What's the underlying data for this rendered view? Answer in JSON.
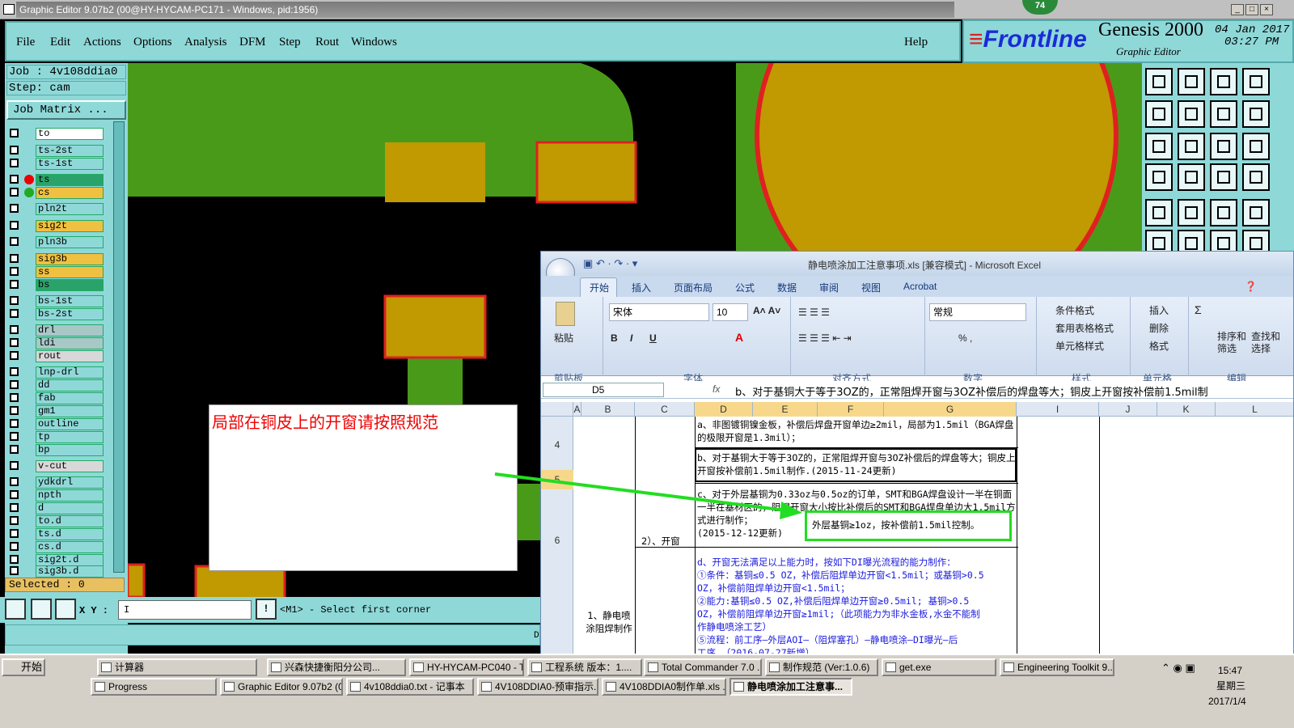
{
  "genesis": {
    "title": "Graphic Editor 9.07b2 (00@HY-HYCAM-PC171 - Windows, pid:1956)",
    "badge": "74",
    "menu": [
      "File",
      "Edit",
      "Actions",
      "Options",
      "Analysis",
      "DFM",
      "Step",
      "Rout",
      "Windows"
    ],
    "help": "Help",
    "brand": "Frontline",
    "product": "Genesis 2000",
    "subtitle": "Graphic Editor",
    "date": "04 Jan 2017",
    "time": "03:27 PM",
    "job": "Job : 4v108ddia0",
    "step": "Step: cam",
    "job_matrix": "Job Matrix ...",
    "layers": [
      {
        "name": "to",
        "color": "#ffffff"
      },
      {
        "name": "ts-2st",
        "color": "#8fd8d8"
      },
      {
        "name": "ts-1st",
        "color": "#8fd8d8"
      },
      {
        "name": "ts",
        "color": "#2aa36a"
      },
      {
        "name": "cs",
        "color": "#f0c040"
      },
      {
        "name": "pln2t",
        "color": "#8fd8d8"
      },
      {
        "name": "sig2t",
        "color": "#f0c040"
      },
      {
        "name": "pln3b",
        "color": "#8fd8d8"
      },
      {
        "name": "sig3b",
        "color": "#f0c040"
      },
      {
        "name": "ss",
        "color": "#f0c040"
      },
      {
        "name": "bs",
        "color": "#2aa36a"
      },
      {
        "name": "bs-1st",
        "color": "#8fd8d8"
      },
      {
        "name": "bs-2st",
        "color": "#8fd8d8"
      },
      {
        "name": "drl",
        "color": "#a8c8c8"
      },
      {
        "name": "ldi",
        "color": "#a8c8c8"
      },
      {
        "name": "rout",
        "color": "#d8d8d8"
      },
      {
        "name": "lnp-drl",
        "color": "#8fd8d8"
      },
      {
        "name": "dd",
        "color": "#8fd8d8"
      },
      {
        "name": "fab",
        "color": "#8fd8d8"
      },
      {
        "name": "gm1",
        "color": "#8fd8d8"
      },
      {
        "name": "outline",
        "color": "#8fd8d8"
      },
      {
        "name": "tp",
        "color": "#8fd8d8"
      },
      {
        "name": "bp",
        "color": "#8fd8d8"
      },
      {
        "name": "v-cut",
        "color": "#d8d8d8"
      },
      {
        "name": "ydkdrl",
        "color": "#8fd8d8"
      },
      {
        "name": "npth",
        "color": "#8fd8d8"
      },
      {
        "name": "d",
        "color": "#8fd8d8"
      },
      {
        "name": "to.d",
        "color": "#8fd8d8"
      },
      {
        "name": "ts.d",
        "color": "#8fd8d8"
      },
      {
        "name": "cs.d",
        "color": "#8fd8d8"
      },
      {
        "name": "sig2t.d",
        "color": "#8fd8d8"
      },
      {
        "name": "sig3b.d",
        "color": "#8fd8d8"
      }
    ],
    "selected": "Selected : 0",
    "xy_label": "X Y :",
    "xy_value": "I",
    "prompt": "<M1> - Select first corner",
    "status_right": "D"
  },
  "note": {
    "text": "局部在铜皮上的开窗请按照规范"
  },
  "excel": {
    "title": "静电喷涂加工注意事项.xls  [兼容模式] - Microsoft Excel",
    "tabs": [
      "开始",
      "插入",
      "页面布局",
      "公式",
      "数据",
      "审阅",
      "视图",
      "Acrobat"
    ],
    "font_name": "宋体",
    "font_size": "10",
    "number_format": "常规",
    "paste": "粘贴",
    "groups": [
      "剪贴板",
      "字体",
      "对齐方式",
      "数字",
      "样式",
      "单元格",
      "编辑"
    ],
    "style_btns": [
      "条件格式",
      "套用表格格式",
      "单元格样式"
    ],
    "cell_btns": [
      "插入",
      "删除",
      "格式"
    ],
    "edit_btns": [
      "排序和筛选",
      "查找和选择"
    ],
    "name_box": "D5",
    "formula": "b、对于基铜大于等于3OZ的，正常阻焊开窗与3OZ补偿后的焊盘等大；铜皮上开窗按补偿前1.5mil制",
    "columns": [
      "A",
      "B",
      "C",
      "D",
      "E",
      "F",
      "G",
      "I",
      "J",
      "K",
      "L"
    ],
    "rows": [
      "4",
      "5",
      "6"
    ],
    "b_col": "1、静电喷涂阻焊制作",
    "c_col": "2）、开窗",
    "r4": "a、非图镀铜镍金板，补偿后焊盘开窗单边≥2mil，局部为1.5mil（BGA焊盘的极限开窗是1.3mil）；",
    "r5": "b、对于基铜大于等于3OZ的，正常阻焊开窗与3OZ补偿后的焊盘等大；铜皮上开窗按补偿前1.5mil制作.(2015-11-24更新)",
    "r6a": "c、对于外层基铜为0.33oz与0.5oz的订单，SMT和BGA焊盘设计一半在铜面一半在基材区的，阻焊开窗大小按比补偿后的SMT和BGA焊盘单边大1.5mil方式进行制作；",
    "r6b": "外层基铜≥1oz，按补偿前1.5mil控制。",
    "r6c": "(2015-12-12更新)",
    "r7": [
      "d、开窗无法满足以上能力时，按如下DI曝光流程的能力制作：",
      "①条件：基铜≤0.5 OZ，补偿后阻焊单边开窗<1.5mil；或基铜>0.5",
      "OZ，补偿前阻焊单边开窗<1.5mil；",
      "②能力:基铜≤0.5 OZ,补偿后阻焊单边开窗≥0.5mil;   基铜>0.5",
      "OZ，补偿前阻焊单边开窗≥1mil;（此项能力为非水金板,水金不能制",
      "作静电喷涂工艺）",
      "⑤流程：前工序—外层AOI—（阻焊塞孔）—静电喷涂—DI曝光—后",
      "工序     （2016-07-27新增）"
    ]
  },
  "taskbar": {
    "start": "开始",
    "row1": [
      "计算器",
      "兴森快捷衡阳分公司...",
      "HY-HYCAM-PC040 - T...",
      "工程系统  版本：1....",
      "Total Commander 7.0 ...",
      "制作规范 (Ver:1.0.6)",
      "get.exe",
      "Engineering Toolkit 9...."
    ],
    "row2": [
      "Progress",
      "Graphic Editor 9.07b2 (0...",
      "4v108ddia0.txt - 记事本",
      "4V108DDIA0-预审指示....",
      "4V108DDIA0制作单.xls ...",
      "静电喷涂加工注意事..."
    ],
    "time": "15:47",
    "weekday": "星期三",
    "date": "2017/1/4"
  },
  "colors": {
    "panel": "#8fd8d8",
    "copper": "#4a9a1a",
    "pad": "#c09a00",
    "outline": "#e02020",
    "highlight": "#22dd22"
  }
}
